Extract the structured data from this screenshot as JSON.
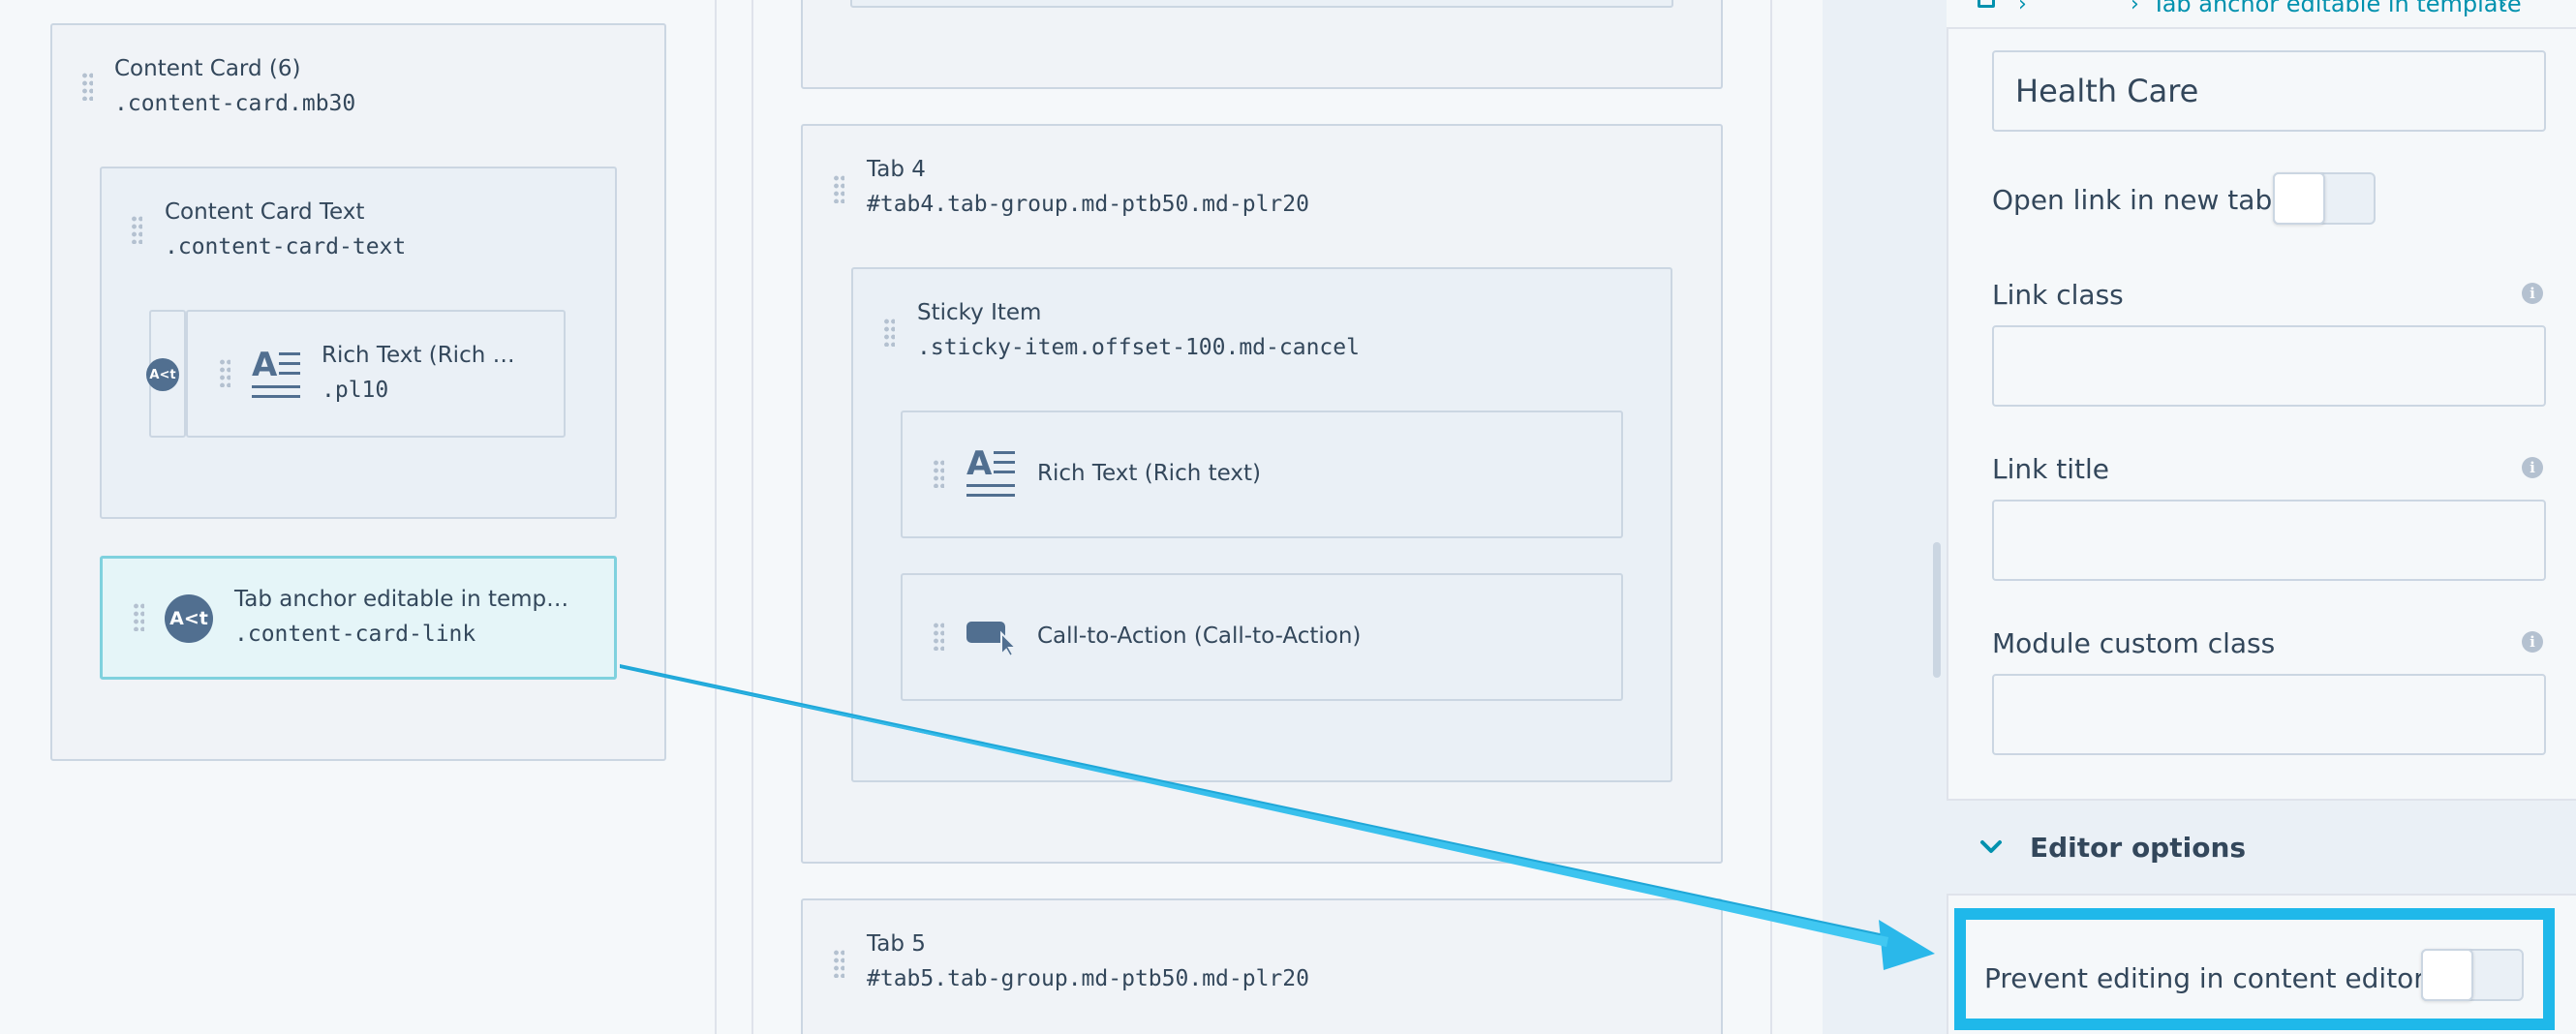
{
  "left_column": {
    "content_card": {
      "title": "Content Card (6)",
      "selector": ".content-card.mb30"
    },
    "content_card_text": {
      "title": "Content Card Text",
      "selector": ".content-card-text"
    },
    "rich_text_small": {
      "title": "Rich Text (Rich …",
      "selector": ".pl10",
      "badge": "A<t"
    },
    "tab_anchor": {
      "title": "Tab anchor editable in temp…",
      "selector": ".content-card-link",
      "badge": "A<t"
    }
  },
  "middle_column": {
    "tab4": {
      "title": "Tab 4",
      "selector": "#tab4.tab-group.md-ptb50.md-plr20"
    },
    "sticky_item": {
      "title": "Sticky Item",
      "selector": ".sticky-item.offset-100.md-cancel"
    },
    "rich_text": {
      "title": "Rich Text (Rich text)"
    },
    "cta": {
      "title": "Call-to-Action (Call-to-Action)"
    },
    "tab5": {
      "title": "Tab 5",
      "selector": "#tab5.tab-group.md-ptb50.md-plr20"
    }
  },
  "right_panel": {
    "breadcrumb": "Tab anchor editable in template",
    "link_text_value": "Health Care",
    "open_new_tab_label": "Open link in new tab",
    "link_class_label": "Link class",
    "link_title_label": "Link title",
    "module_class_label": "Module custom class",
    "editor_options_label": "Editor options",
    "prevent_editing_label": "Prevent editing in content editors",
    "info_glyph": "i"
  },
  "colors": {
    "arrow": "#1fb8ea",
    "highlight": "#1fb8ea",
    "selected_border": "#7fd1de",
    "text": "#33475b",
    "icon": "#516f90"
  },
  "icons": [
    "drag-handle-icon",
    "rich-text-icon",
    "cta-icon",
    "module-avatar-icon",
    "info-icon",
    "chevron-down-icon",
    "breadcrumb-home-icon",
    "chevron-right-icon"
  ]
}
